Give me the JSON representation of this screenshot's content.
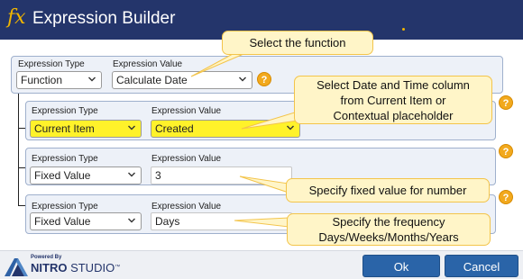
{
  "window": {
    "title": "Expression Builder",
    "icon": "fx-icon",
    "icon_text": "fx"
  },
  "colors": {
    "titlebar": "#24356b",
    "accent_orange": "#f2a91d",
    "highlight_yellow": "#fff22a",
    "callout_fill": "#fff5c8",
    "button_blue": "#2a64a8"
  },
  "rows": [
    {
      "type_label": "Expression Type",
      "type_value": "Function",
      "value_label": "Expression Value",
      "value": "Calculate Date",
      "value_kind": "select"
    },
    {
      "type_label": "Expression Type",
      "type_value": "Current Item",
      "value_label": "Expression Value",
      "value": "Created",
      "value_kind": "select"
    },
    {
      "type_label": "Expression Type",
      "type_value": "Fixed Value",
      "value_label": "Expression Value",
      "value": "3",
      "value_kind": "text"
    },
    {
      "type_label": "Expression Type",
      "type_value": "Fixed Value",
      "value_label": "Expression Value",
      "value": "Days",
      "value_kind": "text"
    }
  ],
  "help_glyph": "?",
  "callouts": {
    "function": "Select the function",
    "date_line1": "Select Date and Time column",
    "date_line2": "from Current Item or",
    "date_line3": "Contextual placeholder",
    "fixed": "Specify fixed value for number",
    "freq_line1": "Specify the frequency",
    "freq_line2": "Days/Weeks/Months/Years"
  },
  "footer": {
    "powered_by": "Powered By",
    "brand_bold": "NITRO",
    "brand_rest": " STUDIO",
    "brand_tm": "™",
    "ok_label": "Ok",
    "cancel_label": "Cancel"
  }
}
